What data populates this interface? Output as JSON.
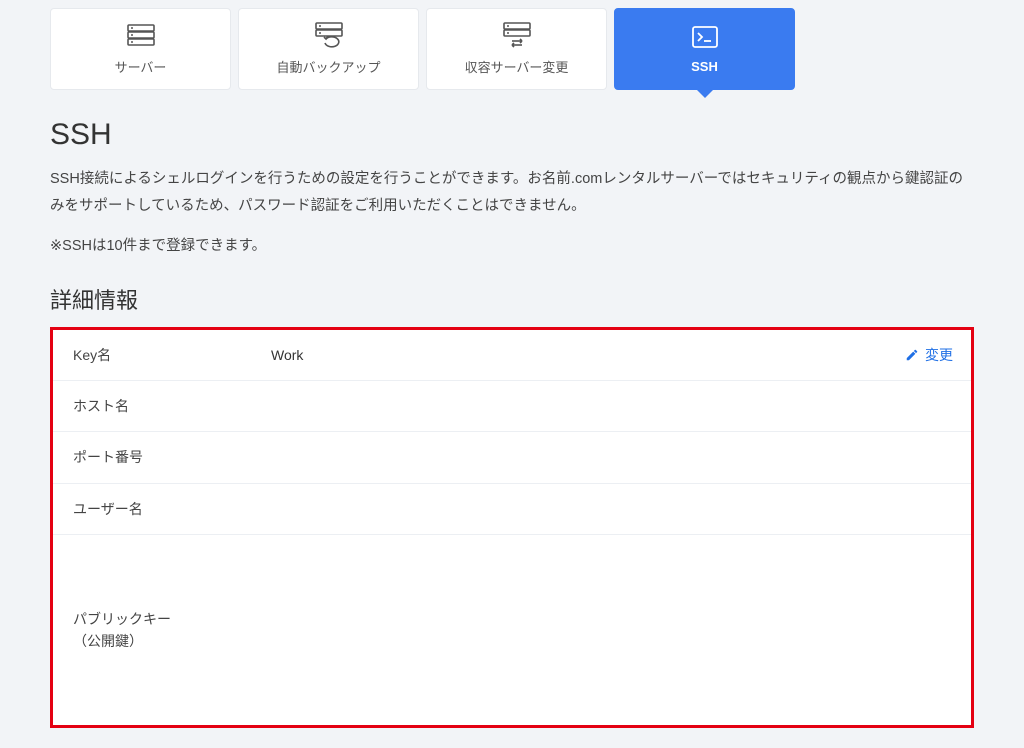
{
  "tabs": {
    "server": {
      "label": "サーバー"
    },
    "backup": {
      "label": "自動バックアップ"
    },
    "migrate": {
      "label": "収容サーバー変更"
    },
    "ssh": {
      "label": "SSH"
    }
  },
  "page": {
    "title": "SSH",
    "desc": "SSH接続によるシェルログインを行うための設定を行うことができます。お名前.comレンタルサーバーではセキュリティの観点から鍵認証のみをサポートしているため、パスワード認証をご利用いただくことはできません。",
    "note": "※SSHは10件まで登録できます。"
  },
  "detail": {
    "section_title": "詳細情報",
    "rows": {
      "key_name": {
        "label": "Key名",
        "value": "Work",
        "edit_label": "変更"
      },
      "host": {
        "label": "ホスト名",
        "value": ""
      },
      "port": {
        "label": "ポート番号",
        "value": ""
      },
      "user": {
        "label": "ユーザー名",
        "value": ""
      },
      "pubkey": {
        "label": "パブリックキー\n（公開鍵）",
        "value": ""
      }
    }
  }
}
